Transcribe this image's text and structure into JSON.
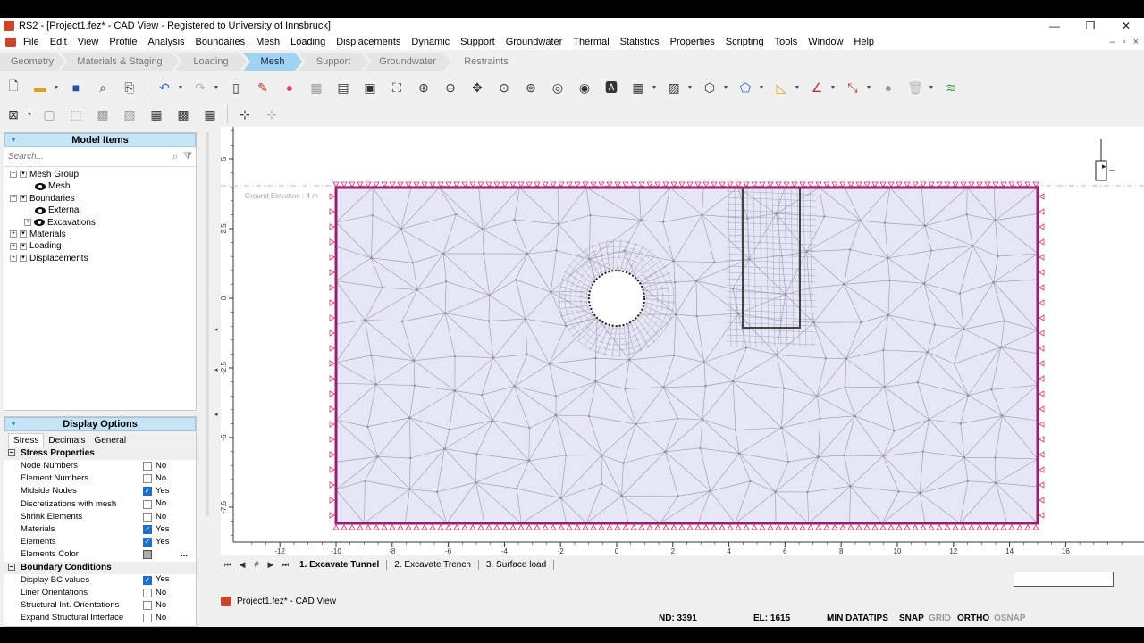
{
  "window": {
    "title": "RS2 - [Project1.fez* - CAD View - Registered to University of Innsbruck]",
    "controls": [
      "—",
      "❐",
      "✕"
    ]
  },
  "menu": [
    "File",
    "Edit",
    "View",
    "Profile",
    "Analysis",
    "Boundaries",
    "Mesh",
    "Loading",
    "Displacements",
    "Dynamic",
    "Support",
    "Groundwater",
    "Thermal",
    "Statistics",
    "Properties",
    "Scripting",
    "Tools",
    "Window",
    "Help"
  ],
  "workflow_tabs": [
    "Geometry",
    "Materials & Staging",
    "Loading",
    "Mesh",
    "Support",
    "Groundwater",
    "Restraints"
  ],
  "active_tab": "Mesh",
  "model_items": {
    "title": "Model Items",
    "search_placeholder": "Search...",
    "tree": [
      {
        "label": "Mesh Group",
        "depth": 0,
        "expander": "-"
      },
      {
        "label": "Mesh",
        "depth": 1,
        "eye": true
      },
      {
        "label": "Boundaries",
        "depth": 0,
        "expander": "-"
      },
      {
        "label": "External",
        "depth": 1,
        "eye": true
      },
      {
        "label": "Excavations",
        "depth": 1,
        "eye": true,
        "expander": "+"
      },
      {
        "label": "Materials",
        "depth": 0,
        "expander": "+"
      },
      {
        "label": "Loading",
        "depth": 0,
        "expander": "+"
      },
      {
        "label": "Displacements",
        "depth": 0,
        "expander": "+"
      }
    ]
  },
  "display_options": {
    "title": "Display Options",
    "tabs": [
      "Stress",
      "Decimals",
      "General"
    ],
    "sections": [
      {
        "title": "Stress Properties",
        "rows": [
          {
            "label": "Node Numbers",
            "checked": false,
            "value": "No"
          },
          {
            "label": "Element Numbers",
            "checked": false,
            "value": "No"
          },
          {
            "label": "Midside Nodes",
            "checked": true,
            "value": "Yes"
          },
          {
            "label": "Discretizations with mesh",
            "checked": false,
            "value": "No"
          },
          {
            "label": "Shrink Elements",
            "checked": false,
            "value": "No"
          },
          {
            "label": "Materials",
            "checked": true,
            "value": "Yes"
          },
          {
            "label": "Elements",
            "checked": true,
            "value": "Yes"
          },
          {
            "label": "Elements Color",
            "swatch": "#aaaaaa",
            "value": "..."
          }
        ]
      },
      {
        "title": "Boundary Conditions",
        "rows": [
          {
            "label": "Display BC values",
            "checked": true,
            "value": "Yes"
          },
          {
            "label": "Liner Orientations",
            "checked": false,
            "value": "No"
          },
          {
            "label": "Structural Int. Orientations",
            "checked": false,
            "value": "No"
          },
          {
            "label": "Expand Structural Interface",
            "checked": false,
            "value": "No"
          }
        ]
      }
    ]
  },
  "viewport": {
    "ground_elevation_label": "Ground Elevation : 4 m",
    "x_ticks": [
      "-12",
      "-10",
      "-8",
      "-6",
      "-4",
      "-2",
      "0",
      "2",
      "4",
      "6",
      "8",
      "10",
      "12",
      "14",
      "16"
    ],
    "y_ticks": [
      "5",
      "2.5",
      "0",
      "-2.5",
      "-5",
      "-7.5"
    ]
  },
  "sheet_tabs": [
    "1. Excavate Tunnel",
    "2. Excavate Trench",
    "3. Surface load"
  ],
  "sheet_nav": [
    "⏮",
    "◀",
    "#",
    "▶",
    "⏭"
  ],
  "document_tab": "Project1.fez* - CAD View",
  "status": {
    "nodes": "ND: 3391",
    "elements": "EL: 1615",
    "datatips": "MIN DATATIPS",
    "snap": "SNAP",
    "grid": "GRID",
    "ortho": "ORTHO",
    "osnap": "OSNAP"
  },
  "colors": {
    "accent": "#9fd3f2",
    "mesh_fill": "#e6e6f6",
    "boundary": "#9a1f6a",
    "restraint": "#e0306a"
  }
}
